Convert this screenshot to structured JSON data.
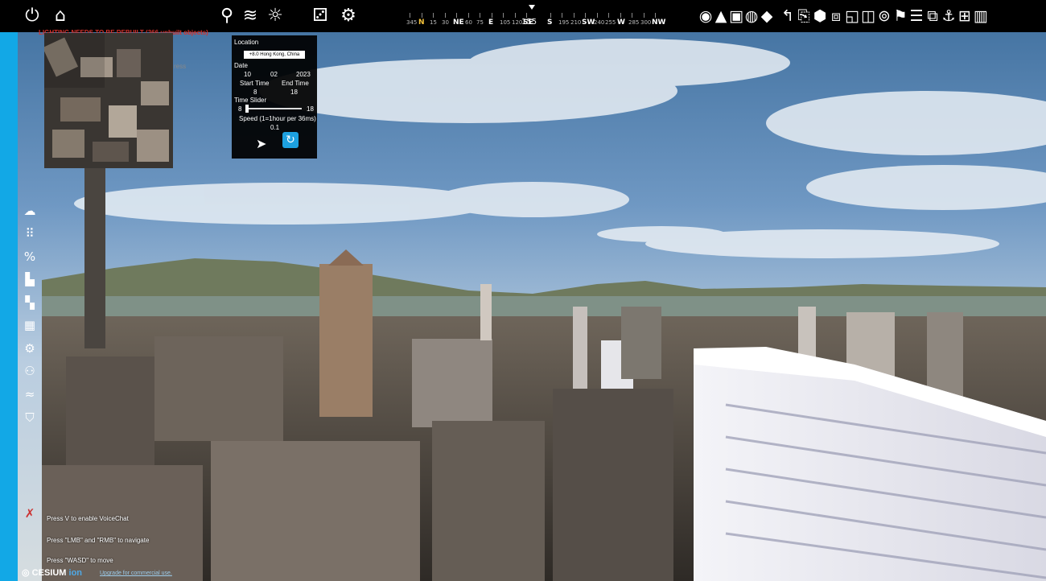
{
  "window": {
    "warning": "LIGHTING NEEDS TO BE REBUILT (366 unbuilt objects)",
    "warning_sub": "ress"
  },
  "toolbar": {
    "left_icons": [
      {
        "name": "power-icon",
        "glyph": "⏻"
      },
      {
        "name": "home-icon",
        "glyph": "⌂"
      }
    ],
    "mid_icons": [
      {
        "name": "location-pin-icon",
        "glyph": "⚲"
      },
      {
        "name": "layers-icon",
        "glyph": "≋"
      },
      {
        "name": "sun-icon",
        "glyph": "☼"
      },
      {
        "name": "gamepad-icon",
        "glyph": "⚂"
      },
      {
        "name": "settings-gear-icon",
        "glyph": "⚙"
      }
    ],
    "right_icons": [
      {
        "name": "globe-view-icon",
        "glyph": "◉"
      },
      {
        "name": "terrain-icon",
        "glyph": "▲"
      },
      {
        "name": "building-block-icon",
        "glyph": "▣"
      },
      {
        "name": "sphere-icon",
        "glyph": "◍"
      },
      {
        "name": "diamond-icon",
        "glyph": "◆"
      },
      {
        "name": "undo-arrow-icon",
        "glyph": "↰"
      },
      {
        "name": "export-icon",
        "glyph": "⎘"
      },
      {
        "name": "hexagon-icon",
        "glyph": "⬢"
      },
      {
        "name": "cube-icon",
        "glyph": "⧈"
      },
      {
        "name": "frame-icon",
        "glyph": "◱"
      },
      {
        "name": "box-icon",
        "glyph": "◫"
      },
      {
        "name": "target-icon",
        "glyph": "⊚"
      },
      {
        "name": "pin-marker-icon",
        "glyph": "⚑"
      },
      {
        "name": "list-icon",
        "glyph": "☰"
      },
      {
        "name": "stack-icon",
        "glyph": "⧉"
      },
      {
        "name": "anchor-icon",
        "glyph": "⚓"
      },
      {
        "name": "circle-grid-icon",
        "glyph": "⊞"
      },
      {
        "name": "chart-icon",
        "glyph": "▥"
      }
    ]
  },
  "compass": {
    "heading": "155",
    "labels": [
      "345",
      "N",
      "15",
      "30",
      "NE",
      "60",
      "75",
      "E",
      "105",
      "120",
      "SE",
      "155",
      "S",
      "195",
      "210",
      "SW",
      "240",
      "255",
      "W",
      "285",
      "300",
      "NW"
    ]
  },
  "panel": {
    "location_label": "Location",
    "location_value": "+8.0 Hong Kong, China",
    "date_label": "Date",
    "date_day": "10",
    "date_month": "02",
    "date_year": "2023",
    "start_time_label": "Start Time",
    "end_time_label": "End Time",
    "start_time_value": "8",
    "end_time_value": "18",
    "time_slider_label": "Time Slider",
    "slider_min": "8",
    "slider_max": "18",
    "speed_label": "Speed (1=1hour per 36ms)",
    "speed_value": "0.1"
  },
  "sidebar": {
    "icons": [
      {
        "name": "gis-cloud-icon",
        "glyph": "☁"
      },
      {
        "name": "grid-dots-icon",
        "glyph": "⠿"
      },
      {
        "name": "percent-icon",
        "glyph": "%"
      },
      {
        "name": "building-icon",
        "glyph": "▙"
      },
      {
        "name": "tiles-icon",
        "glyph": "▚"
      },
      {
        "name": "calculator-icon",
        "glyph": "▦"
      },
      {
        "name": "cog-icon",
        "glyph": "⚙"
      },
      {
        "name": "people-icon",
        "glyph": "⚇"
      },
      {
        "name": "wind-icon",
        "glyph": "≈"
      },
      {
        "name": "shield-icon",
        "glyph": "⛉"
      }
    ],
    "mute_icon": {
      "name": "microphone-muted-icon",
      "glyph": "✗"
    }
  },
  "hints": {
    "voice": "Press V to enable VoiceChat",
    "navigate": "Press \"LMB\" and \"RMB\" to navigate",
    "move": "Press \"WASD\" to move"
  },
  "footer": {
    "logo_main": "CESIUM",
    "logo_ion": "ion",
    "upgrade_link": "Upgrade for commercial use."
  }
}
